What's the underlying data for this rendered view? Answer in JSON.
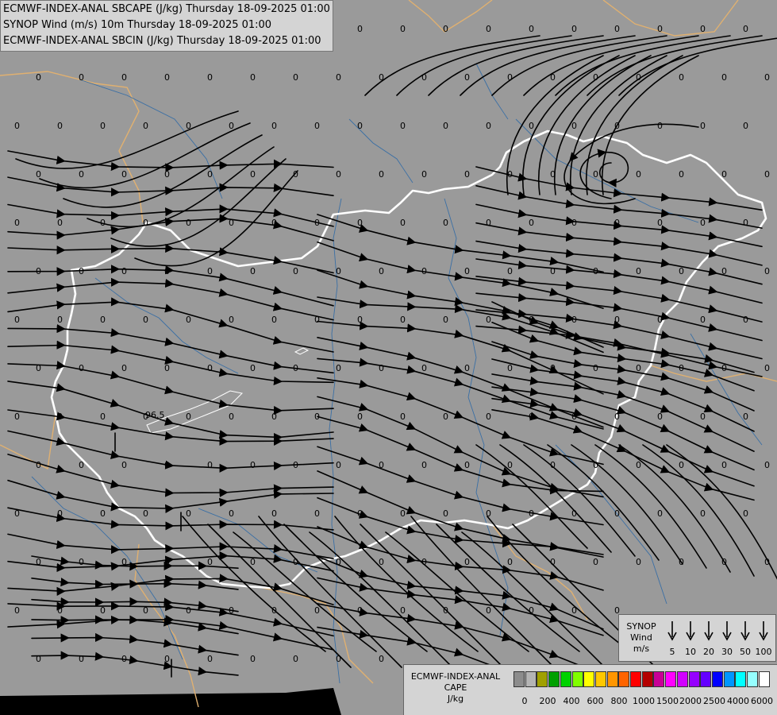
{
  "header": {
    "lines": [
      "ECMWF-INDEX-ANAL SBCAPE (J/kg) Thursday 18-09-2025 01:00",
      "SYNOP Wind (m/s) 10m Thursday 18-09-2025 01:00",
      "ECMWF-INDEX-ANAL SBCIN (J/kg) Thursday 18-09-2025 01:00"
    ]
  },
  "map": {
    "field_value": "0",
    "station_label": "96.5",
    "colors": {
      "background": "#9a9a9a",
      "border_main": "#ffffff",
      "border_neighbors": "#e0b070",
      "rivers": "#3a6fa5",
      "streamlines": "#000000"
    }
  },
  "synop_legend": {
    "title_line1": "SYNOP",
    "title_line2": "Wind",
    "unit": "m/s",
    "values": [
      "5",
      "10",
      "20",
      "30",
      "50",
      "100"
    ]
  },
  "cape_legend": {
    "title_line1": "ECMWF-INDEX-ANAL",
    "title_line2": "CAPE",
    "unit": "J/kg",
    "colors": [
      "#8c8c8c",
      "#b4b4b4",
      "#a0a000",
      "#00a000",
      "#00d200",
      "#80ff00",
      "#ffff00",
      "#ffc800",
      "#ff9600",
      "#ff6400",
      "#ff0000",
      "#b40000",
      "#c80096",
      "#ff00ff",
      "#d200ff",
      "#9600ff",
      "#6400ff",
      "#0000ff",
      "#0096ff",
      "#00ffff",
      "#96ffff",
      "#ffffff"
    ],
    "ticks": [
      "0",
      "200",
      "400",
      "600",
      "800",
      "1000",
      "1500",
      "2000",
      "2500",
      "4000",
      "6000"
    ]
  }
}
